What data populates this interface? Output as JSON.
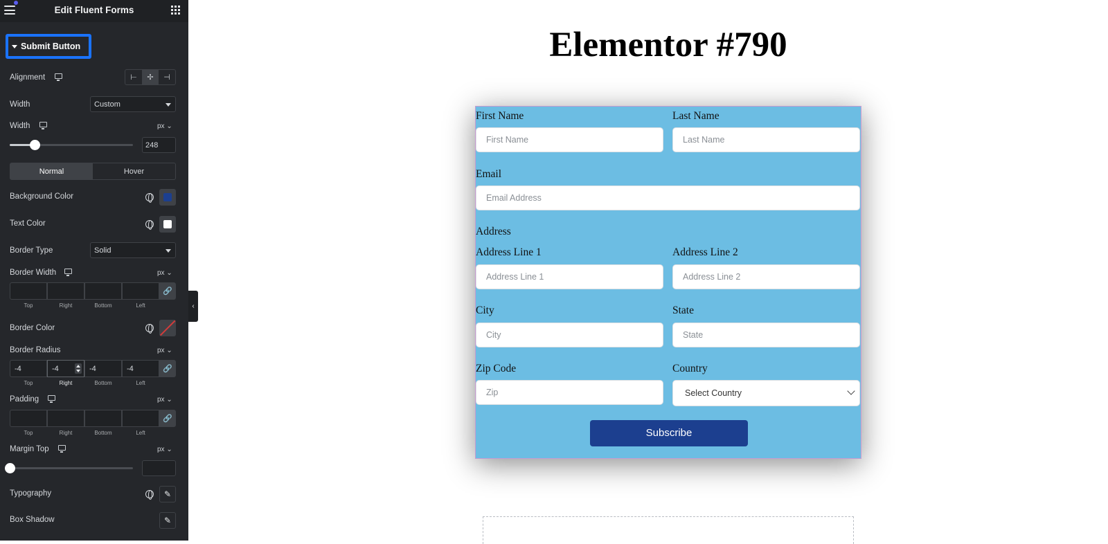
{
  "panel": {
    "title": "Edit Fluent Forms",
    "section_label": "Submit Button",
    "alignment_label": "Alignment",
    "width_type_label": "Width",
    "width_type_value": "Custom",
    "width_label": "Width",
    "width_unit": "px",
    "width_value": "248",
    "width_slider_fraction": 0.2,
    "tabs": [
      "Normal",
      "Hover"
    ],
    "background_color_label": "Background Color",
    "background_color": "#1c3f8f",
    "text_color_label": "Text Color",
    "text_color": "#ffffff",
    "border_type_label": "Border Type",
    "border_type_value": "Solid",
    "border_width_label": "Border Width",
    "border_width_unit": "px",
    "border_width_values": [
      "",
      "",
      "",
      ""
    ],
    "dim_labels": [
      "Top",
      "Right",
      "Bottom",
      "Left"
    ],
    "border_color_label": "Border Color",
    "border_radius_label": "Border Radius",
    "border_radius_unit": "px",
    "border_radius_values": [
      "-4",
      "-4",
      "-4",
      "-4"
    ],
    "padding_label": "Padding",
    "padding_unit": "px",
    "padding_values": [
      "",
      "",
      "",
      ""
    ],
    "margin_top_label": "Margin Top",
    "margin_top_unit": "px",
    "margin_top_value": "",
    "margin_slider_fraction": 0,
    "typography_label": "Typography",
    "box_shadow_label": "Box Shadow"
  },
  "page": {
    "title": "Elementor #790"
  },
  "form": {
    "first_name_label": "First Name",
    "first_name_placeholder": "First Name",
    "last_name_label": "Last Name",
    "last_name_placeholder": "Last Name",
    "email_label": "Email",
    "email_placeholder": "Email Address",
    "address_label": "Address",
    "address1_label": "Address Line 1",
    "address1_placeholder": "Address Line 1",
    "address2_label": "Address Line 2",
    "address2_placeholder": "Address Line 2",
    "city_label": "City",
    "city_placeholder": "City",
    "state_label": "State",
    "state_placeholder": "State",
    "zip_label": "Zip Code",
    "zip_placeholder": "Zip",
    "country_label": "Country",
    "country_value": "Select Country",
    "submit_label": "Subscribe",
    "background_color": "#6cbde3"
  }
}
